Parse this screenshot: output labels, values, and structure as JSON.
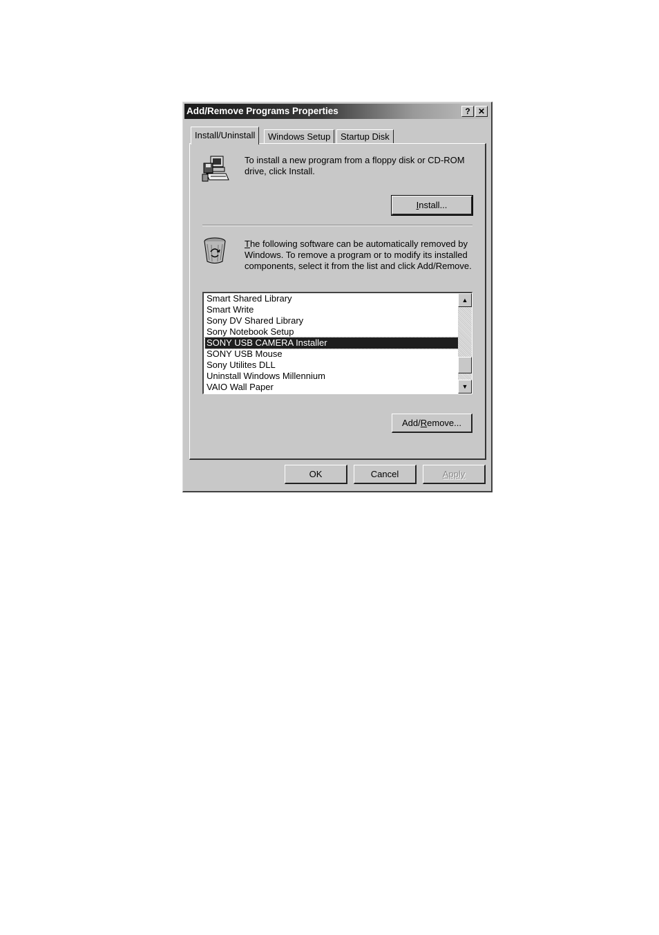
{
  "dialog": {
    "title": "Add/Remove Programs Properties",
    "help_label": "?",
    "close_label": "✕"
  },
  "tabs": [
    {
      "label": "Install/Uninstall",
      "active": true
    },
    {
      "label": "Windows Setup",
      "active": false
    },
    {
      "label": "Startup Disk",
      "active": false
    }
  ],
  "install_section": {
    "icon": "computer-floppy-icon",
    "text": "To install a new program from a floppy disk or CD-ROM drive, click Install.",
    "button_prefix": "I",
    "button_rest": "nstall..."
  },
  "remove_section": {
    "icon": "recycle-bin-icon",
    "text_first": "T",
    "text_rest": "he following software can be automatically removed by Windows. To remove a program or to modify its installed components, select it from the list and click Add/Remove.",
    "programs": [
      "Smart Shared Library",
      "Smart Write",
      "Sony DV Shared Library",
      "Sony Notebook Setup",
      "SONY USB CAMERA Installer",
      "SONY USB Mouse",
      "Sony Utilites DLL",
      "Uninstall Windows Millennium",
      "VAIO Wall Paper"
    ],
    "selected_program": "SONY USB CAMERA Installer",
    "add_remove_prefix": "Add/",
    "add_remove_underline": "R",
    "add_remove_rest": "emove..."
  },
  "footer": {
    "ok_label": "OK",
    "cancel_label": "Cancel",
    "apply_label": "Apply"
  }
}
